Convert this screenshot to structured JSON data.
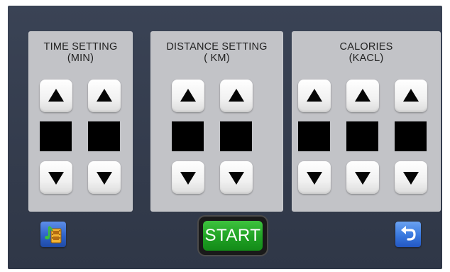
{
  "panels": {
    "time": {
      "title_line1": "TIME SETTING",
      "title_line2": "(MIN)"
    },
    "distance": {
      "title_line1": "DISTANCE SETTING",
      "title_line2": "( KM)"
    },
    "calories": {
      "title_line1": "CALORIES",
      "title_line2": "(KACL)"
    }
  },
  "footer": {
    "start_label": "START",
    "media_icon": "music-film-icon",
    "back_icon": "undo-arrow-icon"
  },
  "colors": {
    "background": "#343c4d",
    "panel": "#c2c3c7",
    "start_green": "#1fa124",
    "icon_blue": "#2f63c8"
  }
}
